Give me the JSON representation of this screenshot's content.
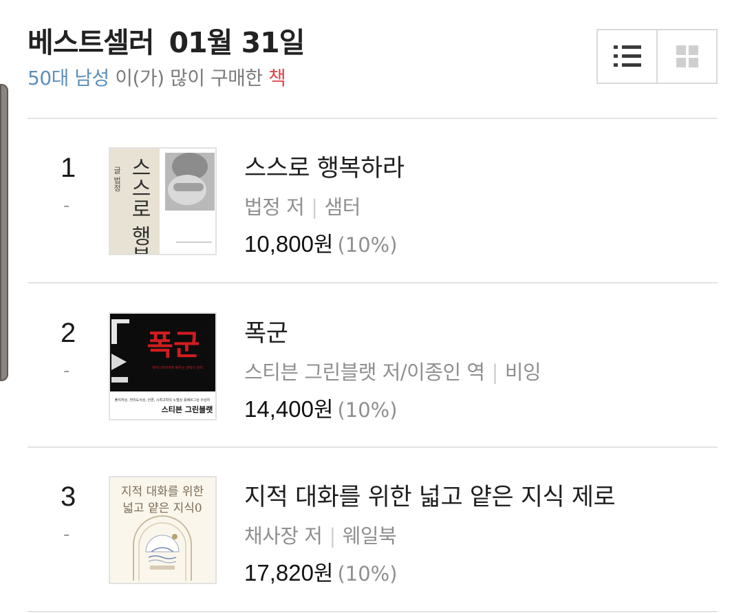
{
  "header": {
    "title": "베스트셀러",
    "date": "01월 31일",
    "subtitle_who": "50대 남성",
    "subtitle_mid": " 이(가) 많이 구매한 ",
    "subtitle_what": "책"
  },
  "view_toggle": {
    "list_icon": "list-view-icon",
    "grid_icon": "grid-view-icon",
    "active": "list"
  },
  "books": [
    {
      "rank": "1",
      "change": "-",
      "title": "스스로 행복하라",
      "author": "법정 저",
      "publisher": "샘터",
      "price": "10,800",
      "unit": "원",
      "discount": "(10%)",
      "cover_text_small": "글 법정",
      "cover_text_main": "스스로 행복하라"
    },
    {
      "rank": "2",
      "change": "-",
      "title": "폭군",
      "author": "스티븐 그린블랫 저/이종인 역",
      "publisher": "비잉",
      "price": "14,400",
      "unit": "원",
      "discount": "(10%)",
      "cover_text_main": "폭군",
      "cover_text_tagline": "셰익스피어에게 배우는 권력의 원리",
      "cover_text_award": "퓰리처상, 전미도서상, 언론, 시최고학의 노벨상 홀베르그상 수상자",
      "cover_text_author": "스티븐 그린블랫"
    },
    {
      "rank": "3",
      "change": "-",
      "title": "지적 대화를 위한 넓고 얕은 지식 제로",
      "author": "채사장 저",
      "publisher": "웨일북",
      "price": "17,820",
      "unit": "원",
      "discount": "(10%)",
      "cover_text_line1": "지적 대화를 위한",
      "cover_text_line2": "넓고 얕은 지식0"
    }
  ],
  "colors": {
    "subtitle_accent": "#5d8fb9",
    "subtitle_highlight": "#e0474c",
    "cover2_red": "#d01c20"
  }
}
